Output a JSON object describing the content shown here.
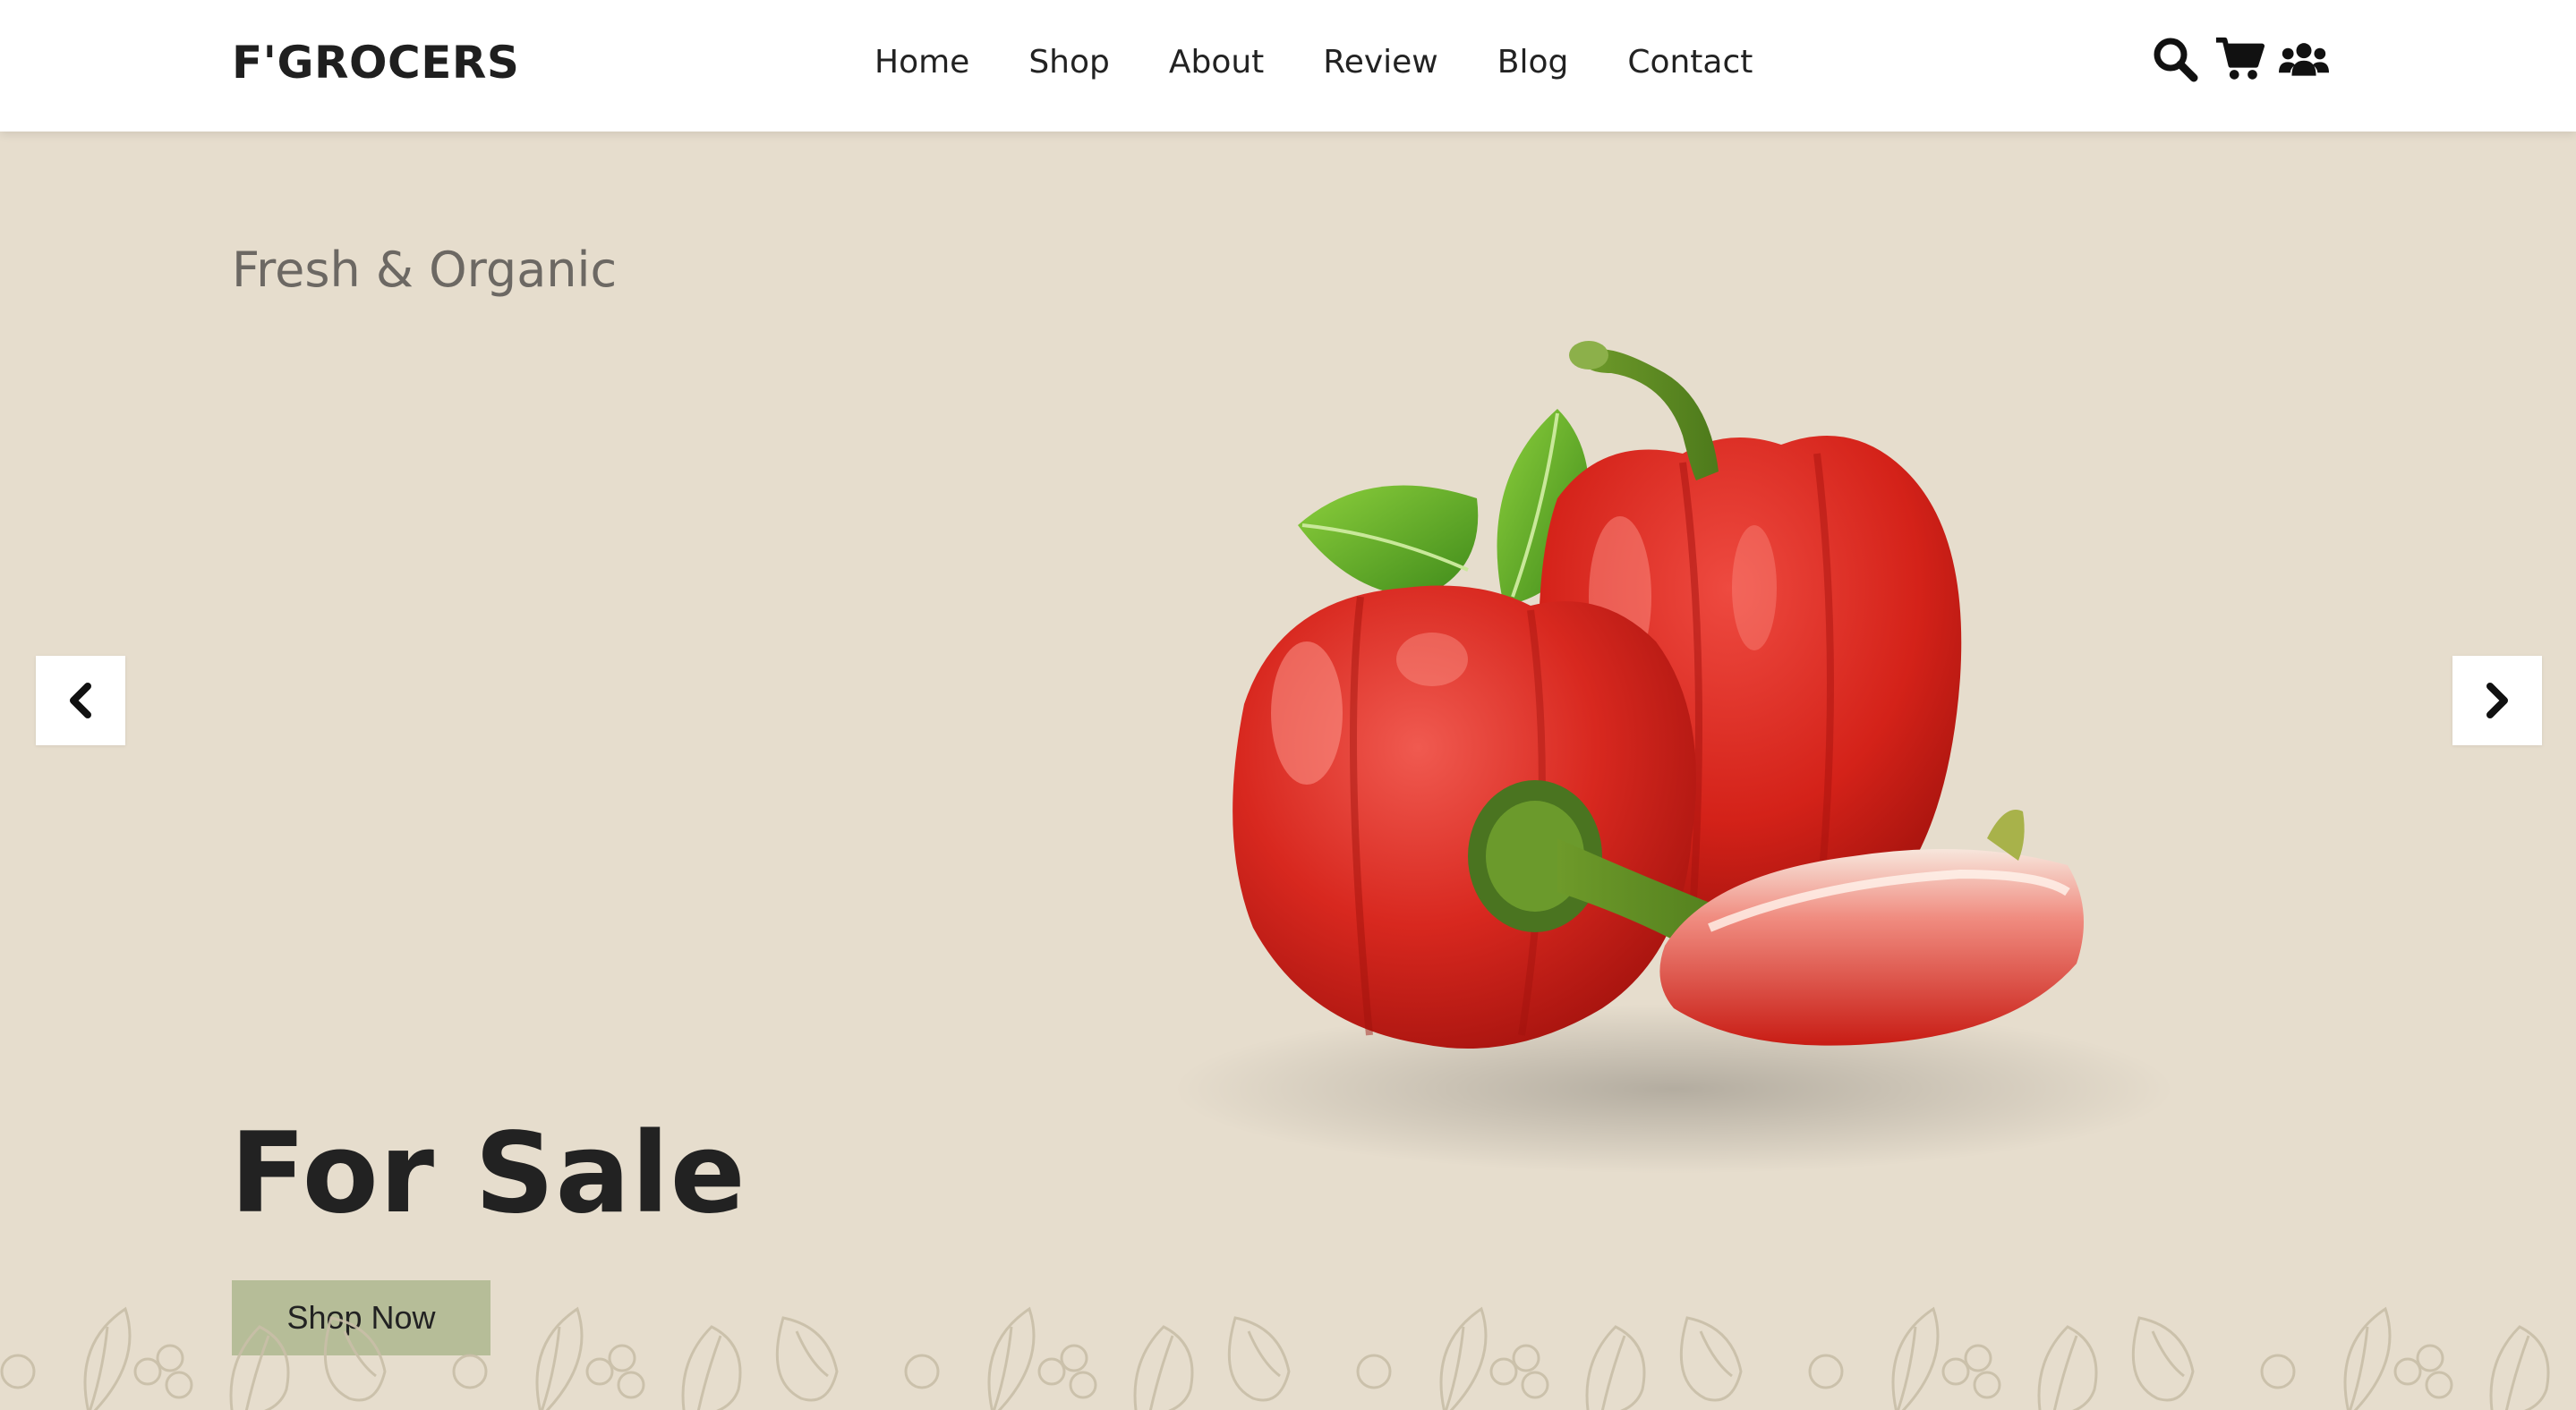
{
  "header": {
    "logo": "F'GROCERS",
    "nav": [
      "Home",
      "Shop",
      "About",
      "Review",
      "Blog",
      "Contact"
    ],
    "icons": [
      "search-icon",
      "cart-icon",
      "users-icon"
    ]
  },
  "hero": {
    "subtitle": "Fresh & Organic",
    "title": "For Sale",
    "button": "Shop Now",
    "prev_icon": "chevron-left-icon",
    "next_icon": "chevron-right-icon",
    "image": "red-bell-peppers",
    "colors": {
      "background": "#e6ddcd",
      "button": "#b6bd98",
      "text": "#222222",
      "subtitle": "#6c6863"
    }
  }
}
